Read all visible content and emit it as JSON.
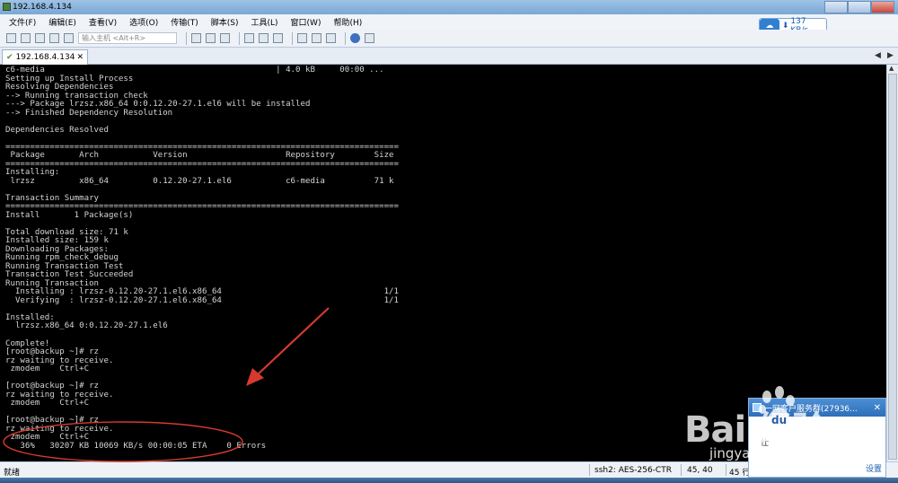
{
  "window": {
    "title": "192.168.4.134"
  },
  "menu": [
    "文件(F)",
    "编辑(E)",
    "查看(V)",
    "选项(O)",
    "传输(T)",
    "脚本(S)",
    "工具(L)",
    "窗口(W)",
    "帮助(H)"
  ],
  "toolbar": {
    "host_placeholder": "输入主机 <Alt+R>"
  },
  "speed": "137 KB/s",
  "tab": {
    "label": "192.168.4.134"
  },
  "terminal": {
    "lines": [
      "c6-media                                               | 4.0 kB     00:00 ...",
      "Setting up Install Process",
      "Resolving Dependencies",
      "--> Running transaction check",
      "---> Package lrzsz.x86_64 0:0.12.20-27.1.el6 will be installed",
      "--> Finished Dependency Resolution",
      "",
      "Dependencies Resolved",
      "",
      "================================================================================",
      " Package       Arch           Version                    Repository        Size",
      "================================================================================",
      "Installing:",
      " lrzsz         x86_64         0.12.20-27.1.el6           c6-media          71 k",
      "",
      "Transaction Summary",
      "================================================================================",
      "Install       1 Package(s)",
      "",
      "Total download size: 71 k",
      "Installed size: 159 k",
      "Downloading Packages:",
      "Running rpm_check_debug",
      "Running Transaction Test",
      "Transaction Test Succeeded",
      "Running Transaction",
      "  Installing : lrzsz-0.12.20-27.1.el6.x86_64                                 1/1",
      "  Verifying  : lrzsz-0.12.20-27.1.el6.x86_64                                 1/1",
      "",
      "Installed:",
      "  lrzsz.x86_64 0:0.12.20-27.1.el6",
      "",
      "Complete!",
      "[root@backup ~]# rz",
      "rz waiting to receive.",
      " zmodem    Ctrl+C",
      "",
      "[root@backup ~]# rz",
      "rz waiting to receive.",
      " zmodem    Ctrl+C",
      "",
      "[root@backup ~]# rz",
      "rz waiting to receive.",
      " zmodem    Ctrl+C",
      "   36%   30207 KB 10069 KB/s 00:00:05 ETA    0 Errors"
    ]
  },
  "status": {
    "ready": "就绪",
    "cipher": "ssh2: AES-256-CTR",
    "position": "45, 40",
    "rows": "45 行, 1"
  },
  "popup": {
    "title": "一网客户服务群(27936...",
    "message": "仕",
    "settings": "设置"
  },
  "watermark": {
    "brand": "Bai  经验",
    "site": "jingyan.baidu.com"
  },
  "colors": {
    "terminal_bg": "#000000",
    "terminal_fg": "#d4d4d4",
    "annotation": "#d63a2e"
  }
}
